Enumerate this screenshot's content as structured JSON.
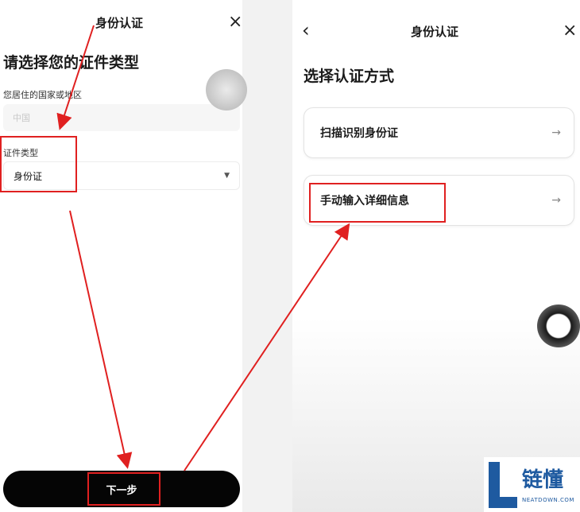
{
  "left": {
    "header_title": "身份认证",
    "heading": "请选择您的证件类型",
    "country_label": "您居住的国家或地区",
    "country_value": "中国",
    "doc_type_label": "证件类型",
    "doc_type_value": "身份证",
    "next_button": "下一步"
  },
  "right": {
    "header_title": "身份认证",
    "heading": "选择认证方式",
    "options": [
      {
        "label": "扫描识别身份证"
      },
      {
        "label": "手动输入详细信息"
      }
    ]
  },
  "icons": {
    "close": "×",
    "back": "‹",
    "arrow": "→",
    "caret": "▼"
  },
  "watermark": {
    "cn": "链懂",
    "en": "NEATDOWN.COM"
  },
  "colors": {
    "highlight": "#e02020",
    "primary_button": "#050505",
    "watermark_blue": "#1e5aa0"
  }
}
